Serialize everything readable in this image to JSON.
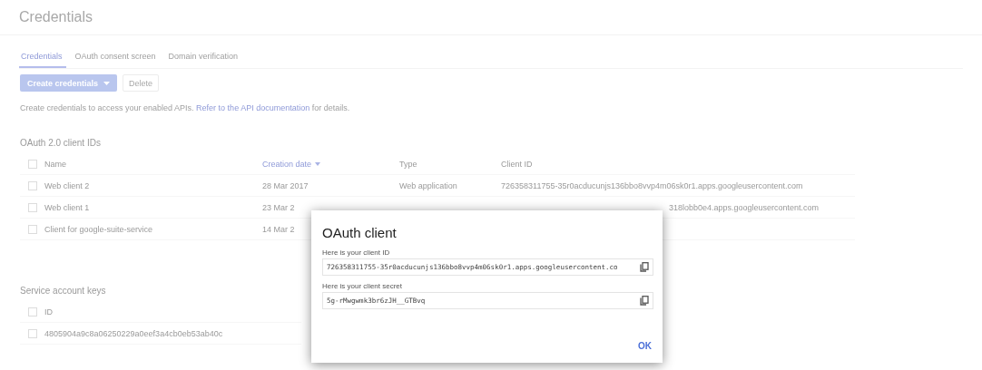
{
  "page_title": "Credentials",
  "tabs": [
    {
      "label": "Credentials",
      "selected": true
    },
    {
      "label": "OAuth consent screen",
      "selected": false
    },
    {
      "label": "Domain verification",
      "selected": false
    }
  ],
  "toolbar": {
    "create_button": "Create credentials",
    "delete_button": "Delete"
  },
  "description": {
    "text": "Create credentials to access your enabled APIs.",
    "link": "Refer to the API documentation",
    "suffix": "for details."
  },
  "oauth_section": {
    "title": "OAuth 2.0 client IDs",
    "select_all_checked": false,
    "columns": [
      "Name",
      "Creation date",
      "Type",
      "Client ID"
    ],
    "rows": [
      {
        "checked": false,
        "name": "Web client 2",
        "date": "28 Mar 2017",
        "type": "Web application",
        "client_id": "726358311755-35r0acducunjs136bbo8vvp4m06sk0r1.apps.googleusercontent.com",
        "kind": "full"
      },
      {
        "checked": false,
        "name": "Web client 1",
        "date": "23 Mar 2",
        "client_id": "318lobb0e4.apps.googleusercontent.com",
        "kind": "clipped"
      },
      {
        "checked": false,
        "name": "Client for google-suite-service",
        "date": "14 Mar 2",
        "kind": "clipped"
      }
    ]
  },
  "service_section": {
    "title": "Service account keys",
    "select_all_checked": false,
    "columns": [
      "ID"
    ],
    "rows": [
      {
        "checked": false,
        "id": "4805904a9c8a06250229a0eef3a4cb0eb53ab40c"
      }
    ]
  },
  "dialog": {
    "title": "OAuth client",
    "fields": [
      {
        "label": "Here is your client ID",
        "value": "726358311755-35r0acducunjs136bbo8vvp4m06sk0r1.apps.googleusercontent.co"
      },
      {
        "label": "Here is your client secret",
        "value": "5g-rMwgwmk3br6zJH__GTBvq"
      }
    ],
    "ok_button": "OK"
  }
}
